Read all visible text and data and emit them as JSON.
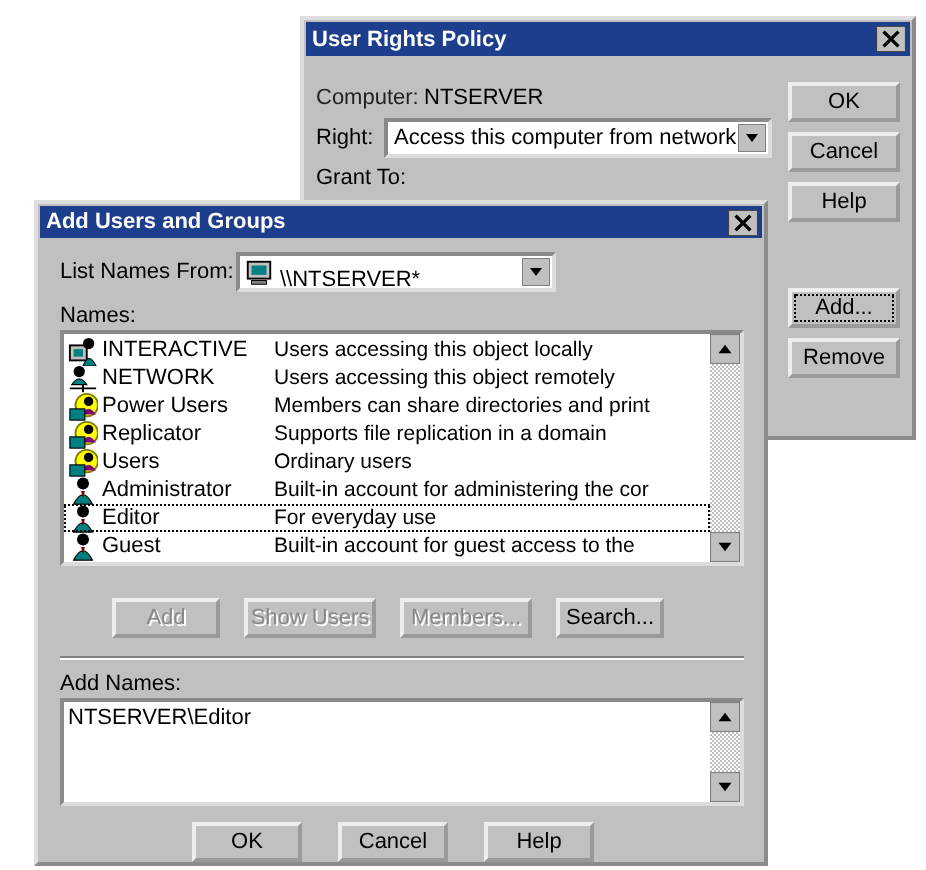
{
  "policy_window": {
    "title": "User Rights Policy",
    "computer_label": "Computer:",
    "computer": "NTSERVER",
    "right_label": "Right:",
    "right": "Access this computer from network",
    "grant_label": "Grant To:",
    "buttons": [
      {
        "label": "OK",
        "focused": false
      },
      {
        "label": "Cancel",
        "focused": false
      },
      {
        "label": "Help",
        "focused": false
      }
    ],
    "list_buttons": [
      {
        "label": "Add...",
        "focused": true
      },
      {
        "label": "Remove",
        "focused": false
      }
    ]
  },
  "add_dialog": {
    "title": "Add Users and Groups",
    "list_from_label": "List Names From:",
    "list_from": "\\\\NTSERVER*",
    "names_label": "Names:",
    "names": [
      {
        "kind": "interactive",
        "name": "INTERACTIVE",
        "description": "Users accessing this object locally",
        "focused": false
      },
      {
        "kind": "network",
        "name": "NETWORK",
        "description": "Users accessing this object remotely",
        "focused": false
      },
      {
        "kind": "group",
        "name": "Power Users",
        "description": "Members can share directories and print",
        "focused": false
      },
      {
        "kind": "group",
        "name": "Replicator",
        "description": "Supports file replication in a domain",
        "focused": false
      },
      {
        "kind": "group",
        "name": "Users",
        "description": "Ordinary users",
        "focused": false
      },
      {
        "kind": "user",
        "name": "Administrator",
        "description": "Built-in account for administering the cor",
        "focused": false
      },
      {
        "kind": "user",
        "name": "Editor",
        "description": "For everyday use",
        "focused": true
      },
      {
        "kind": "user",
        "name": "Guest",
        "description": "Built-in account for guest access to the",
        "focused": false
      }
    ],
    "action_buttons": [
      {
        "label": "Add",
        "disabled": true
      },
      {
        "label": "Show Users",
        "disabled": true
      },
      {
        "label": "Members...",
        "disabled": true
      },
      {
        "label": "Search...",
        "disabled": false
      }
    ],
    "add_names_label": "Add Names:",
    "add_names": "NTSERVER\\Editor",
    "buttons": [
      {
        "label": "OK"
      },
      {
        "label": "Cancel"
      },
      {
        "label": "Help"
      }
    ]
  }
}
